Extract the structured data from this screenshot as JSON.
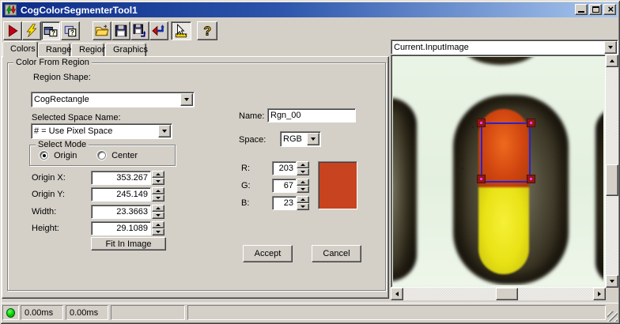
{
  "window": {
    "title": "CogColorSegmenterTool1"
  },
  "toolbar": {
    "buttons": [
      "run",
      "trigger",
      "show-image-electrodes",
      "float-window",
      "open-file",
      "save",
      "save-as",
      "reset",
      "pointer-ruler",
      "help"
    ],
    "pressed": [
      "show-image-electrodes",
      "pointer-ruler"
    ]
  },
  "tabs": {
    "items": [
      {
        "label": "Colors"
      },
      {
        "label": "Range"
      },
      {
        "label": "Region"
      },
      {
        "label": "Graphics"
      }
    ],
    "selected": "Colors"
  },
  "colors_tab": {
    "group_title": "Color From Region",
    "region_shape_label": "Region Shape:",
    "region_shape_value": "CogRectangle",
    "space_name_label": "Selected Space Name:",
    "space_name_value": "# = Use Pixel Space",
    "select_mode": {
      "title": "Select Mode",
      "origin": "Origin",
      "center": "Center",
      "selected": "Origin"
    },
    "rows": [
      {
        "label": "Origin X:",
        "value": "353.267"
      },
      {
        "label": "Origin Y:",
        "value": "245.149"
      },
      {
        "label": "Width:",
        "value": "23.3663"
      },
      {
        "label": "Height:",
        "value": "29.1089"
      }
    ],
    "fit_in_image": "Fit In Image",
    "name_label": "Name:",
    "name_value": "Rgn_00",
    "space_label": "Space:",
    "space_value": "RGB",
    "rgb_rows": [
      {
        "label": "R:",
        "value": "203"
      },
      {
        "label": "G:",
        "value": "67"
      },
      {
        "label": "B:",
        "value": "23"
      }
    ],
    "swatch_style": "background:#c8431f",
    "accept": "Accept",
    "cancel": "Cancel"
  },
  "image_panel": {
    "source": "Current.InputImage",
    "colors": {
      "background": "#e9f3e4",
      "capsule_top": "#d0450f",
      "capsule_bottom": "#e8e215",
      "selection_line": "#2a22cc",
      "selection_handle": "#8c1a12",
      "handle_dot": "#ff30ff"
    }
  },
  "statusbar": {
    "led_color": "#00d000",
    "time1": "0.00ms",
    "time2": "0.00ms"
  }
}
